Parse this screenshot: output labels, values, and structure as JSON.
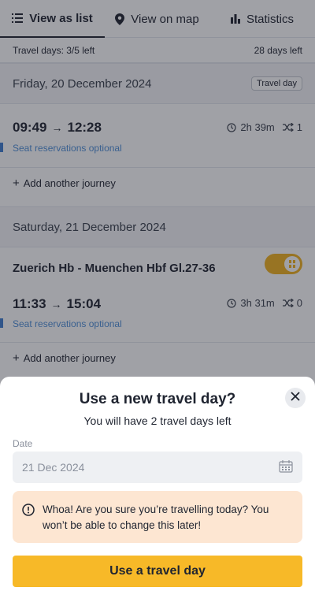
{
  "tabs": [
    {
      "label": "View as list",
      "icon": "list-icon",
      "active": true
    },
    {
      "label": "View on map",
      "icon": "map-pin-icon",
      "active": false
    },
    {
      "label": "Statistics",
      "icon": "bar-chart-icon",
      "active": false
    }
  ],
  "summary": {
    "travel_days": "Travel days: 3/5 left",
    "days_left": "28 days left"
  },
  "days": [
    {
      "date": "Friday, 20 December 2024",
      "tag": "Travel day",
      "journeys": [
        {
          "depart": "09:49",
          "arrive": "12:28",
          "duration": "2h 39m",
          "changes": "1",
          "seat_note": "Seat reservations optional"
        }
      ],
      "add_label": "Add another journey"
    },
    {
      "date": "Saturday, 21 December 2024",
      "route": "Zuerich Hb - Muenchen Hbf Gl.27-36",
      "toggle_on": true,
      "journeys": [
        {
          "depart": "11:33",
          "arrive": "15:04",
          "duration": "3h 31m",
          "changes": "0",
          "seat_note": "Seat reservations optional"
        }
      ],
      "add_label": "Add another journey"
    }
  ],
  "sheet": {
    "title": "Use a new travel day?",
    "subtitle": "You will have 2 travel days left",
    "date_label": "Date",
    "date_value": "21 Dec 2024",
    "warning": "Whoa! Are you sure you’re travelling today? You won’t be able to change this later!",
    "cta": "Use a travel day"
  },
  "colors": {
    "accent": "#f7b928",
    "toggle": "#f2b11e",
    "warning_bg": "#fde6d2",
    "seat_note": "#4f8fd8"
  }
}
